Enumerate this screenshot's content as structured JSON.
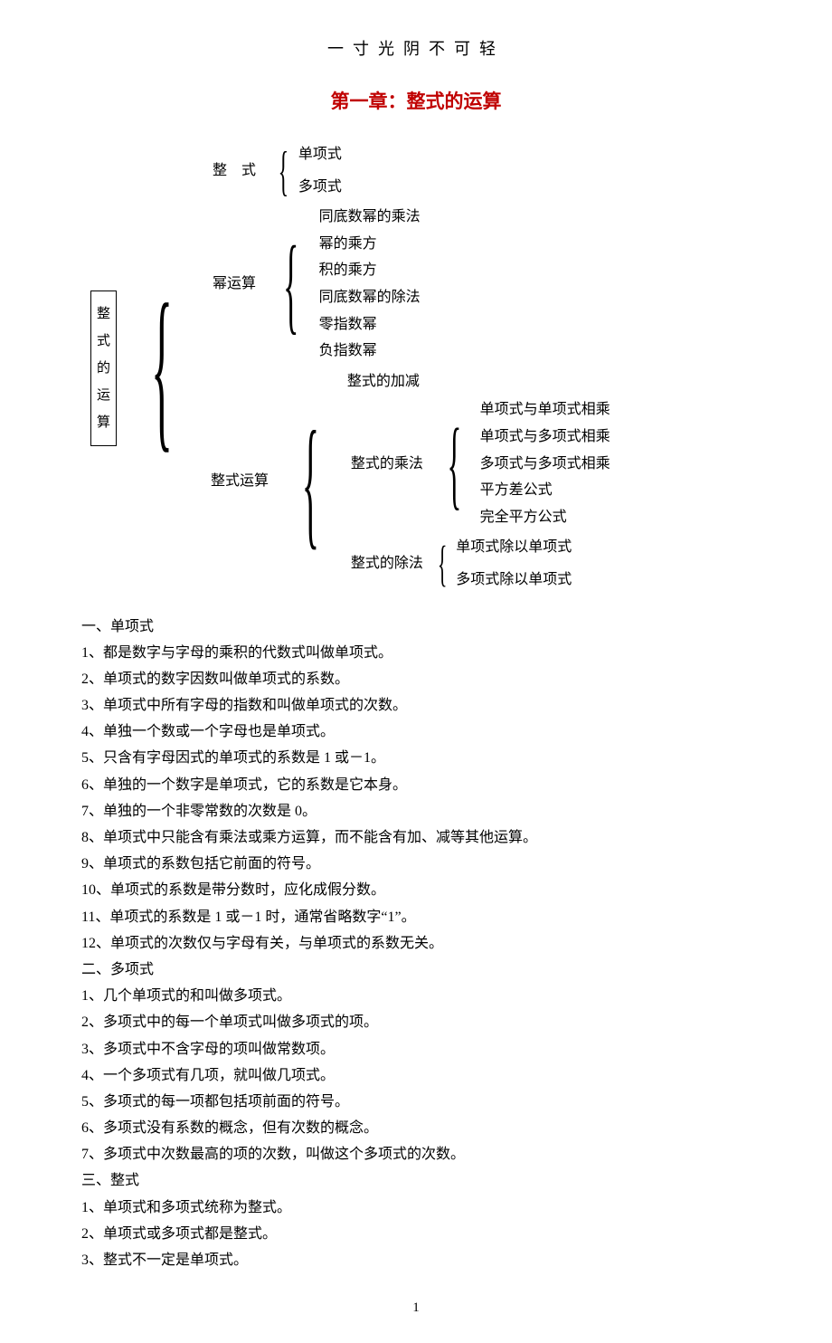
{
  "header_phrase": "一寸光阴不可轻",
  "chapter_title": "第一章：整式的运算",
  "diagram": {
    "root_chars": [
      "整",
      "式",
      "的",
      "运",
      "算"
    ],
    "branch1_label": "整  式",
    "branch1_items": [
      "单项式",
      "多项式"
    ],
    "branch2_label": "幂运算",
    "branch2_items": [
      "同底数幂的乘法",
      "幂的乘方",
      "积的乘方",
      "同底数幂的除法",
      "零指数幂",
      "负指数幂"
    ],
    "branch3_label": "整式运算",
    "branch3_sub1": "整式的加减",
    "branch3_sub2_label": "整式的乘法",
    "branch3_sub2_items": [
      "单项式与单项式相乘",
      "单项式与多项式相乘",
      "多项式与多项式相乘",
      "平方差公式",
      "完全平方公式"
    ],
    "branch3_sub3_label": "整式的除法",
    "branch3_sub3_items": [
      "单项式除以单项式",
      "多项式除以单项式"
    ]
  },
  "sections": [
    {
      "head": "一、单项式",
      "lines": [
        "1、都是数字与字母的乘积的代数式叫做单项式。",
        "2、单项式的数字因数叫做单项式的系数。",
        "3、单项式中所有字母的指数和叫做单项式的次数。",
        "4、单独一个数或一个字母也是单项式。",
        "5、只含有字母因式的单项式的系数是 1 或－1。",
        "6、单独的一个数字是单项式，它的系数是它本身。",
        "7、单独的一个非零常数的次数是 0。",
        "8、单项式中只能含有乘法或乘方运算，而不能含有加、减等其他运算。",
        "9、单项式的系数包括它前面的符号。",
        "10、单项式的系数是带分数时，应化成假分数。",
        "11、单项式的系数是 1 或－1 时，通常省略数字“1”。",
        "12、单项式的次数仅与字母有关，与单项式的系数无关。"
      ]
    },
    {
      "head": "二、多项式",
      "lines": [
        "1、几个单项式的和叫做多项式。",
        "2、多项式中的每一个单项式叫做多项式的项。",
        "3、多项式中不含字母的项叫做常数项。",
        "4、一个多项式有几项，就叫做几项式。",
        "5、多项式的每一项都包括项前面的符号。",
        "6、多项式没有系数的概念，但有次数的概念。",
        "7、多项式中次数最高的项的次数，叫做这个多项式的次数。"
      ]
    },
    {
      "head": "三、整式",
      "lines": [
        "1、单项式和多项式统称为整式。",
        "2、单项式或多项式都是整式。",
        "3、整式不一定是单项式。"
      ]
    }
  ],
  "page_number": "1"
}
